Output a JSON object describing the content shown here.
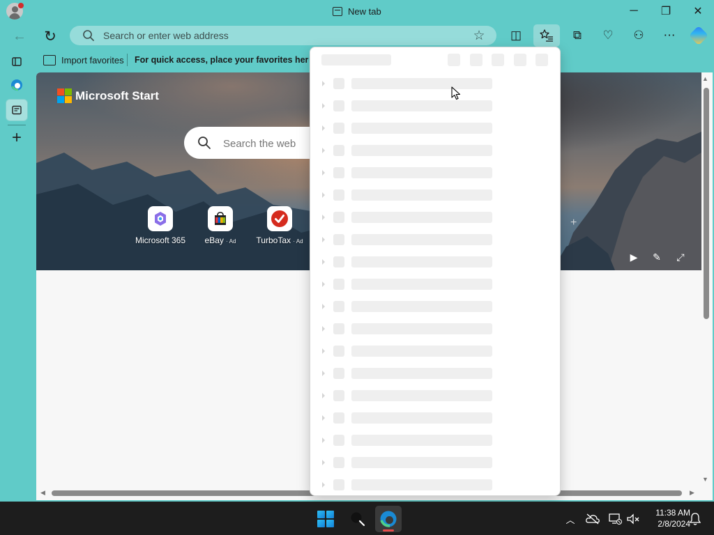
{
  "window": {
    "tab_title": "New tab",
    "minimize_glyph": "─",
    "restore_glyph": "❐",
    "close_glyph": "✕"
  },
  "toolbar": {
    "back_glyph": "←",
    "refresh_glyph": "↻",
    "address_placeholder": "Search or enter web address",
    "favorite_star_glyph": "☆",
    "split_screen_glyph": "◫",
    "favorites_glyph": "☆",
    "collections_glyph": "⧉",
    "browser_essentials_glyph": "♡",
    "extensions_glyph": "⚇",
    "more_glyph": "⋯"
  },
  "favorites_bar": {
    "import_label": "Import favorites",
    "hint": "For quick access, place your favorites here on the favorites bar."
  },
  "sidebar": {
    "add_glyph": "+"
  },
  "start_page": {
    "brand": "Microsoft Start",
    "search_placeholder": "Search the web",
    "tiles": [
      {
        "label": "Microsoft 365",
        "ad": ""
      },
      {
        "label": "eBay",
        "ad": "· Ad"
      },
      {
        "label": "TurboTax",
        "ad": "· Ad"
      }
    ],
    "add_tile_glyph": "+",
    "play_glyph": "▶",
    "customize_glyph": "✎",
    "fullscreen_glyph": "⤢"
  },
  "favorites_flyout": {
    "state": "loading",
    "placeholder_rows": 19
  },
  "taskbar": {
    "tray_chevron": "︿",
    "clock_time": "11:38 AM",
    "clock_date": "2/8/2024"
  },
  "colors": {
    "browser_frame": "#60cbc8",
    "address_bar": "#96dcda",
    "taskbar": "#1d1d1d",
    "skeleton": "#efefef"
  }
}
